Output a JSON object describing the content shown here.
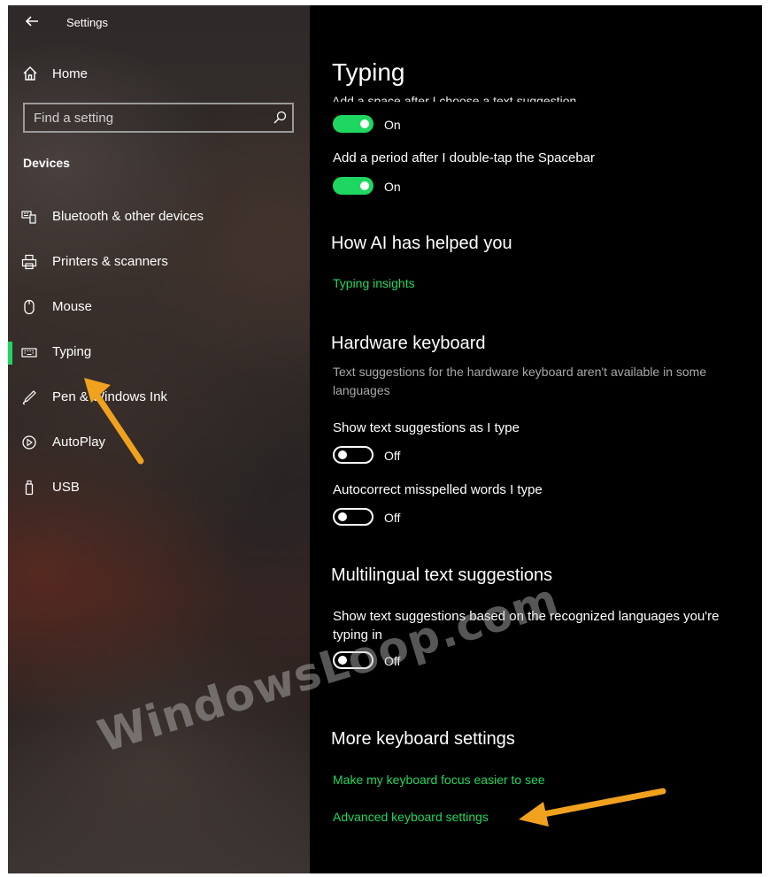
{
  "sidebar": {
    "title": "Settings",
    "home_label": "Home",
    "search_placeholder": "Find a setting",
    "section_header": "Devices",
    "items": [
      {
        "label": "Bluetooth & other devices",
        "icon": "bluetooth-devices-icon"
      },
      {
        "label": "Printers & scanners",
        "icon": "printer-icon"
      },
      {
        "label": "Mouse",
        "icon": "mouse-icon"
      },
      {
        "label": "Typing",
        "icon": "keyboard-icon",
        "selected": true
      },
      {
        "label": "Pen & Windows Ink",
        "icon": "pen-icon"
      },
      {
        "label": "AutoPlay",
        "icon": "autoplay-icon"
      },
      {
        "label": "USB",
        "icon": "usb-icon"
      }
    ]
  },
  "main": {
    "title": "Typing",
    "partial_label": "Add a space after I choose a text suggestion",
    "toggle_1_state": "On",
    "setting_period_label": "Add a period after I double-tap the Spacebar",
    "toggle_2_state": "On",
    "ai_heading": "How AI has helped you",
    "typing_insights_link": "Typing insights",
    "hardware_heading": "Hardware keyboard",
    "hardware_desc": "Text suggestions for the hardware keyboard aren't available in some languages",
    "show_suggestions_label": "Show text suggestions as I type",
    "toggle_3_state": "Off",
    "autocorrect_label": "Autocorrect misspelled words I type",
    "toggle_4_state": "Off",
    "multilingual_heading": "Multilingual text suggestions",
    "multilingual_label": "Show text suggestions based on the recognized languages you're typing in",
    "toggle_5_state": "Off",
    "more_heading": "More keyboard settings",
    "focus_link": "Make my keyboard focus easier to see",
    "advanced_link": "Advanced keyboard settings"
  },
  "overlay": {
    "watermark": "WindowsLoop.com",
    "arrow_color": "#f0a21e"
  },
  "colors": {
    "accent": "#1ed760",
    "background": "#000000",
    "description": "#a9a9a9"
  }
}
